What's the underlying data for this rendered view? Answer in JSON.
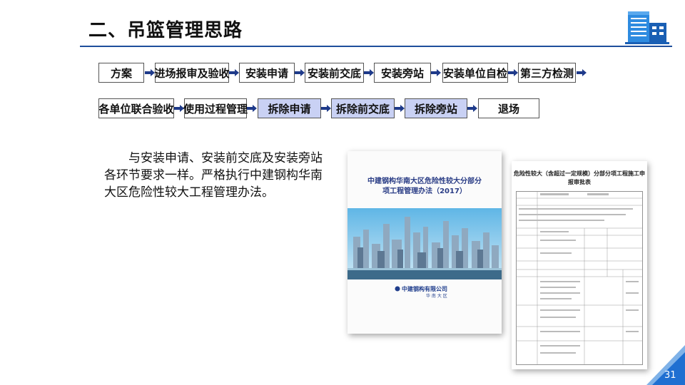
{
  "header": {
    "title": "二、吊篮管理思路",
    "logo_icon": "office-building-icon"
  },
  "flow": {
    "row1": [
      "方案",
      "进场报审及验收",
      "安装申请",
      "安装前交底",
      "安装旁站",
      "安装单位自检",
      "第三方检测"
    ],
    "row2": [
      "各单位联合验收",
      "使用过程管理",
      "拆除申请",
      "拆除前交底",
      "拆除旁站",
      "退场"
    ],
    "row2_highlighted": [
      "拆除申请",
      "拆除前交底",
      "拆除旁站"
    ],
    "arrow_icon": "right-arrow-icon",
    "highlight_color": "#c9d1f4"
  },
  "body_text": "与安装申请、安装前交底及安装旁站各环节要求一样。严格执行中建钢构华南大区危险性较大工程管理办法。",
  "doc_cover": {
    "title_line1": "中建钢构华南大区危险性较大分部分",
    "title_line2": "项工程管理办法（2017）",
    "company": "中建钢构有限公司",
    "region": "华 南 大 区"
  },
  "doc_form": {
    "title_line1": "危险性较大（含超过一定规模）分部分项工程施工申",
    "title_line2": "报审批表"
  },
  "footer": {
    "page_number": "31",
    "accent_color": "#1f6fd1"
  }
}
